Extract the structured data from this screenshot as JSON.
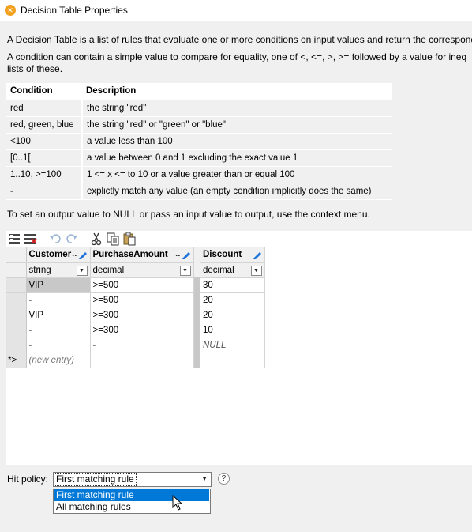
{
  "window": {
    "title": "Decision Table Properties",
    "icon": "altova-icon"
  },
  "intro": {
    "line1": "A Decision Table is a list of rules that evaluate one or more conditions on input values and return the correspond",
    "line2": "A condition can contain a simple value to compare for equality, one of <, <=, >, >= followed by a value for ineq",
    "line3": "lists of these."
  },
  "conditions": {
    "headers": [
      "Condition",
      "Description"
    ],
    "rows": [
      [
        "red",
        "the string \"red\""
      ],
      [
        "red, green, blue",
        "the string \"red\" or \"green\" or \"blue\""
      ],
      [
        "<100",
        "a value less than 100"
      ],
      [
        "[0..1[",
        "a value between 0 and 1 excluding the exact value 1"
      ],
      [
        "1..10, >=100",
        "1 <= x <= to 10 or a value greater than or equal 100"
      ],
      [
        "-",
        "explictly match any value (an empty condition implicitly does the same)"
      ]
    ]
  },
  "context_note": "To set an output value to NULL or pass an input value to output, use the context menu.",
  "toolbar": {
    "icons": [
      "insert-rows-icon",
      "delete-rows-icon",
      "undo-icon",
      "redo-icon",
      "cut-icon",
      "copy-icon",
      "paste-icon"
    ]
  },
  "grid": {
    "columns": [
      {
        "name": "Customer",
        "type": "string"
      },
      {
        "name": "PurchaseAmount",
        "type": "decimal"
      },
      {
        "name": "Discount",
        "type": "decimal"
      }
    ],
    "ellipsis": "..",
    "rows": [
      [
        "VIP",
        ">=500",
        "30"
      ],
      [
        "-",
        ">=500",
        "20"
      ],
      [
        "VIP",
        ">=300",
        "20"
      ],
      [
        "-",
        ">=300",
        "10"
      ],
      [
        "-",
        "-",
        "NULL"
      ]
    ],
    "new_entry": "(new entry)",
    "new_entry_marker": "*>"
  },
  "hit_policy": {
    "label": "Hit policy:",
    "selected": "First matching rule",
    "options": [
      "First matching rule",
      "All matching rules"
    ],
    "help": "?"
  },
  "colors": {
    "selection": "#0078d7",
    "accent_icon": "#f2a11f",
    "pen": "#1e73d8"
  }
}
